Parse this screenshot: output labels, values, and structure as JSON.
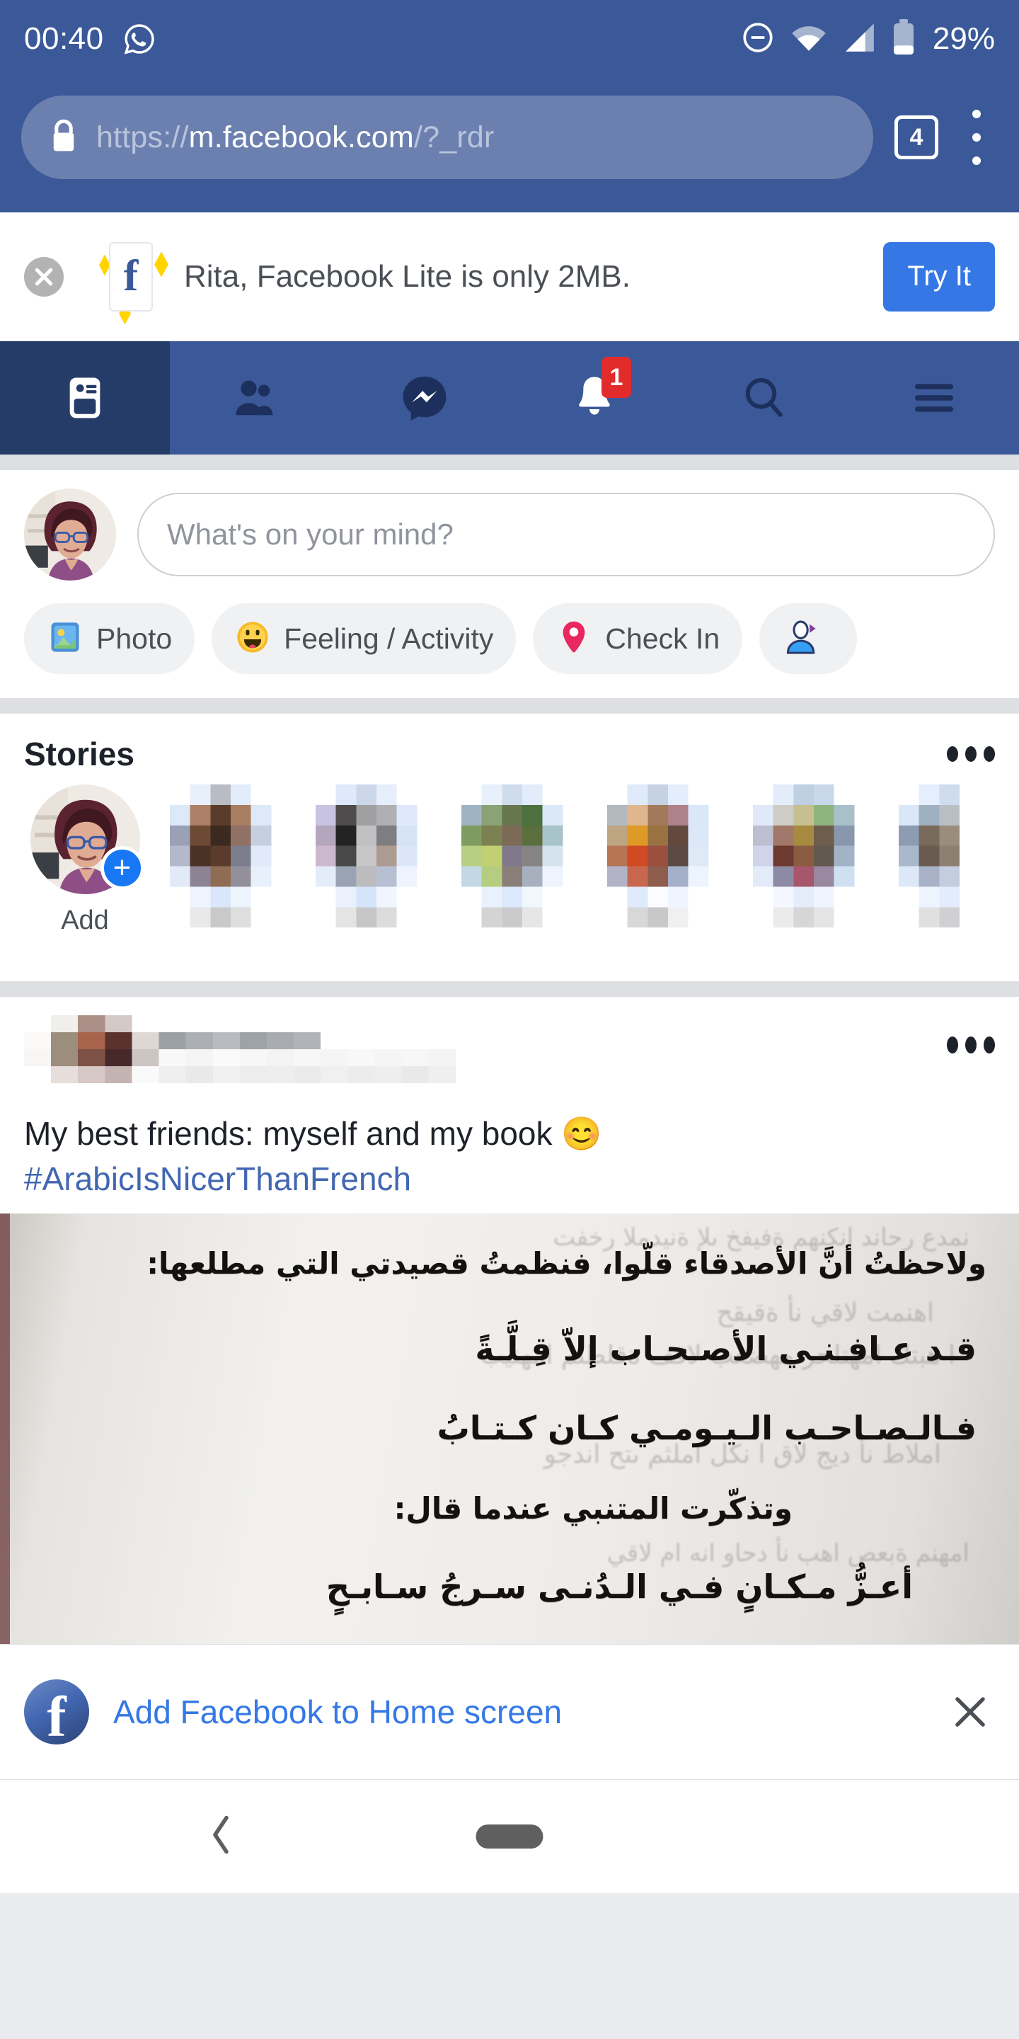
{
  "status_bar": {
    "time": "00:40",
    "battery_percent": "29%",
    "icons": [
      "whatsapp-icon",
      "do-not-disturb-icon",
      "wifi-icon",
      "cellular-signal-icon",
      "battery-icon"
    ]
  },
  "browser": {
    "url_scheme": "https://",
    "url_host": "m.facebook.com",
    "url_path": "/?_rdr",
    "url_full": "https://m.facebook.com/?_rdr",
    "tab_count": "4",
    "secure_icon": "lock-icon",
    "menu_icon": "overflow-menu-icon"
  },
  "lite_banner": {
    "message": "Rita, Facebook Lite is only 2MB.",
    "cta_label": "Try It",
    "close_icon": "close-icon",
    "app_icon_letter": "f",
    "cta_color": "#3578E5"
  },
  "nav": {
    "items": [
      {
        "name": "news-feed",
        "icon": "news-feed-icon",
        "active": true,
        "badge": ""
      },
      {
        "name": "friends",
        "icon": "friends-icon",
        "active": false,
        "badge": ""
      },
      {
        "name": "messenger",
        "icon": "messenger-icon",
        "active": false,
        "badge": ""
      },
      {
        "name": "notifications",
        "icon": "bell-icon",
        "active": false,
        "badge": "1"
      },
      {
        "name": "search",
        "icon": "search-icon",
        "active": false,
        "badge": ""
      },
      {
        "name": "menu",
        "icon": "hamburger-menu-icon",
        "active": false,
        "badge": ""
      }
    ],
    "bar_color": "#3B5998",
    "active_color": "#253C68",
    "badge_color": "#E22C2C"
  },
  "composer": {
    "placeholder": "What's on your mind?",
    "avatar_name": "user-avatar",
    "chips": [
      {
        "label": "Photo",
        "icon": "photo-icon"
      },
      {
        "label": "Feeling / Activity",
        "icon": "smiley-icon"
      },
      {
        "label": "Check In",
        "icon": "location-pin-icon"
      },
      {
        "label": "",
        "icon": "tag-friends-icon"
      }
    ]
  },
  "stories": {
    "title": "Stories",
    "menu_icon": "overflow-menu-icon",
    "add_label": "Add",
    "add_badge_icon": "plus-icon",
    "thumbnails": [
      {
        "name": "story-thumbnail-1"
      },
      {
        "name": "story-thumbnail-2"
      },
      {
        "name": "story-thumbnail-3"
      },
      {
        "name": "story-thumbnail-4"
      },
      {
        "name": "story-thumbnail-5"
      },
      {
        "name": "story-thumbnail-6"
      }
    ]
  },
  "post": {
    "author_redacted": true,
    "menu_icon": "overflow-menu-icon",
    "text": "My best friends: myself and my book 😊",
    "hashtag": "#ArabicIsNicerThanFrench",
    "hashtag_color": "#4267B2",
    "image_name": "arabic-book-page-photo",
    "image_lines": [
      "ولاحظتُ أنَّ الأصدقاء قلّوا، فنظمتُ قصيدتي التي مطلعها:",
      "قـد عـافـنـي الأصـحـاب إلاّ قِـلَّـةً",
      "فـالـصـاحـب الـيـومـي كـان كـتـابُ",
      "وتذكّرت المتنبي عندما قال:",
      "أعـزُّ مـكـانٍ فـي الـدُنـى سـرجُ سـابـحٍ"
    ]
  },
  "home_banner": {
    "label": "Add Facebook to Home screen",
    "icon": "facebook-round-icon",
    "icon_letter": "f",
    "close_icon": "close-icon",
    "link_color": "#3578E5"
  },
  "android_nav": {
    "back_icon": "back-chevron-icon",
    "home_icon": "home-pill-icon"
  }
}
